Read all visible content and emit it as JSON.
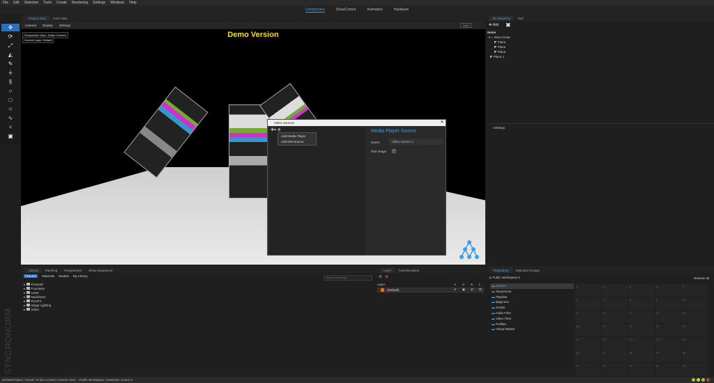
{
  "menu": [
    "File",
    "Edit",
    "Selection",
    "Tools",
    "Create",
    "Rendering",
    "Settings",
    "Windows",
    "Help"
  ],
  "modes": [
    "Construction",
    "ShowControl",
    "Animation",
    "Hardware"
  ],
  "viewport_tabs": [
    "Project View",
    "CAD View"
  ],
  "viewport_menu": [
    "Camera",
    "Display",
    "Settings"
  ],
  "viewport": {
    "live_label": "Live",
    "demo_label": "Demo Version",
    "camera_info": "Perspective View : Editor Camera",
    "layer_info": "Current Layer: Default"
  },
  "dialog": {
    "title": "Video Sources",
    "menu_items": [
      "Add Media Player",
      "Add NDI Source"
    ],
    "heading": "Media Player Source",
    "name_label": "Name:",
    "name_value": "Video Source 1",
    "test_image_label": "Test Image",
    "test_image_checked": true
  },
  "hierarchy": {
    "tabs": [
      "3D Hierarchy",
      "Tool"
    ],
    "add_label": "Add",
    "name_header": "Name",
    "group": "New Group",
    "children": [
      "Plane",
      "Plane",
      "Plane"
    ],
    "sibling": "Plane 1"
  },
  "settings_label": "Settings",
  "library": {
    "tabs": [
      "Library",
      "Patching",
      "Programmer",
      "Show Sequencer"
    ],
    "subtabs": [
      "Fixtures",
      "Materials",
      "Models",
      "My Library"
    ],
    "search_placeholder": "Search in Library",
    "items": [
      "Firework",
      "Fountains",
      "Laser",
      "Machinery",
      "PyroFX",
      "Stage Lighting",
      "Video"
    ]
  },
  "layer": {
    "tabs": [
      "Layer",
      "Transformation"
    ],
    "header": "Layer",
    "cols": [
      "A",
      "V",
      "S",
      "L"
    ],
    "row": "(Default)"
  },
  "repository": {
    "tabs": [
      "Repository",
      "Selection Groups"
    ],
    "workspace": "Public Workspace",
    "release_label": "Release all",
    "items": [
      "Scenes",
      "Sequences",
      "Playlists",
      "MagCues",
      "Scripts",
      "Audio Files",
      "Video Files",
      "Profiles",
      "Virtual Master"
    ],
    "grid": [
      "1",
      "2",
      "3",
      "4",
      "5",
      "6",
      "7",
      "8",
      "9",
      "10",
      "11",
      "12",
      "13",
      "14",
      "15",
      "16",
      "17",
      "18",
      "19",
      "20",
      "21",
      "22",
      "23",
      "24",
      "25",
      "26",
      "27",
      "28",
      "29",
      "30",
      "31",
      "32",
      "33",
      "34",
      "35"
    ]
  },
  "status": "preNewProject | Visual: 37 fps Locked | Current User: - Public Workspace | Selection Count: 0",
  "brand": "SYNCRONORM",
  "colors": {
    "accent": "#4da3e8",
    "demo": "#ffe000",
    "selected_tool": "#2d6fb8"
  }
}
